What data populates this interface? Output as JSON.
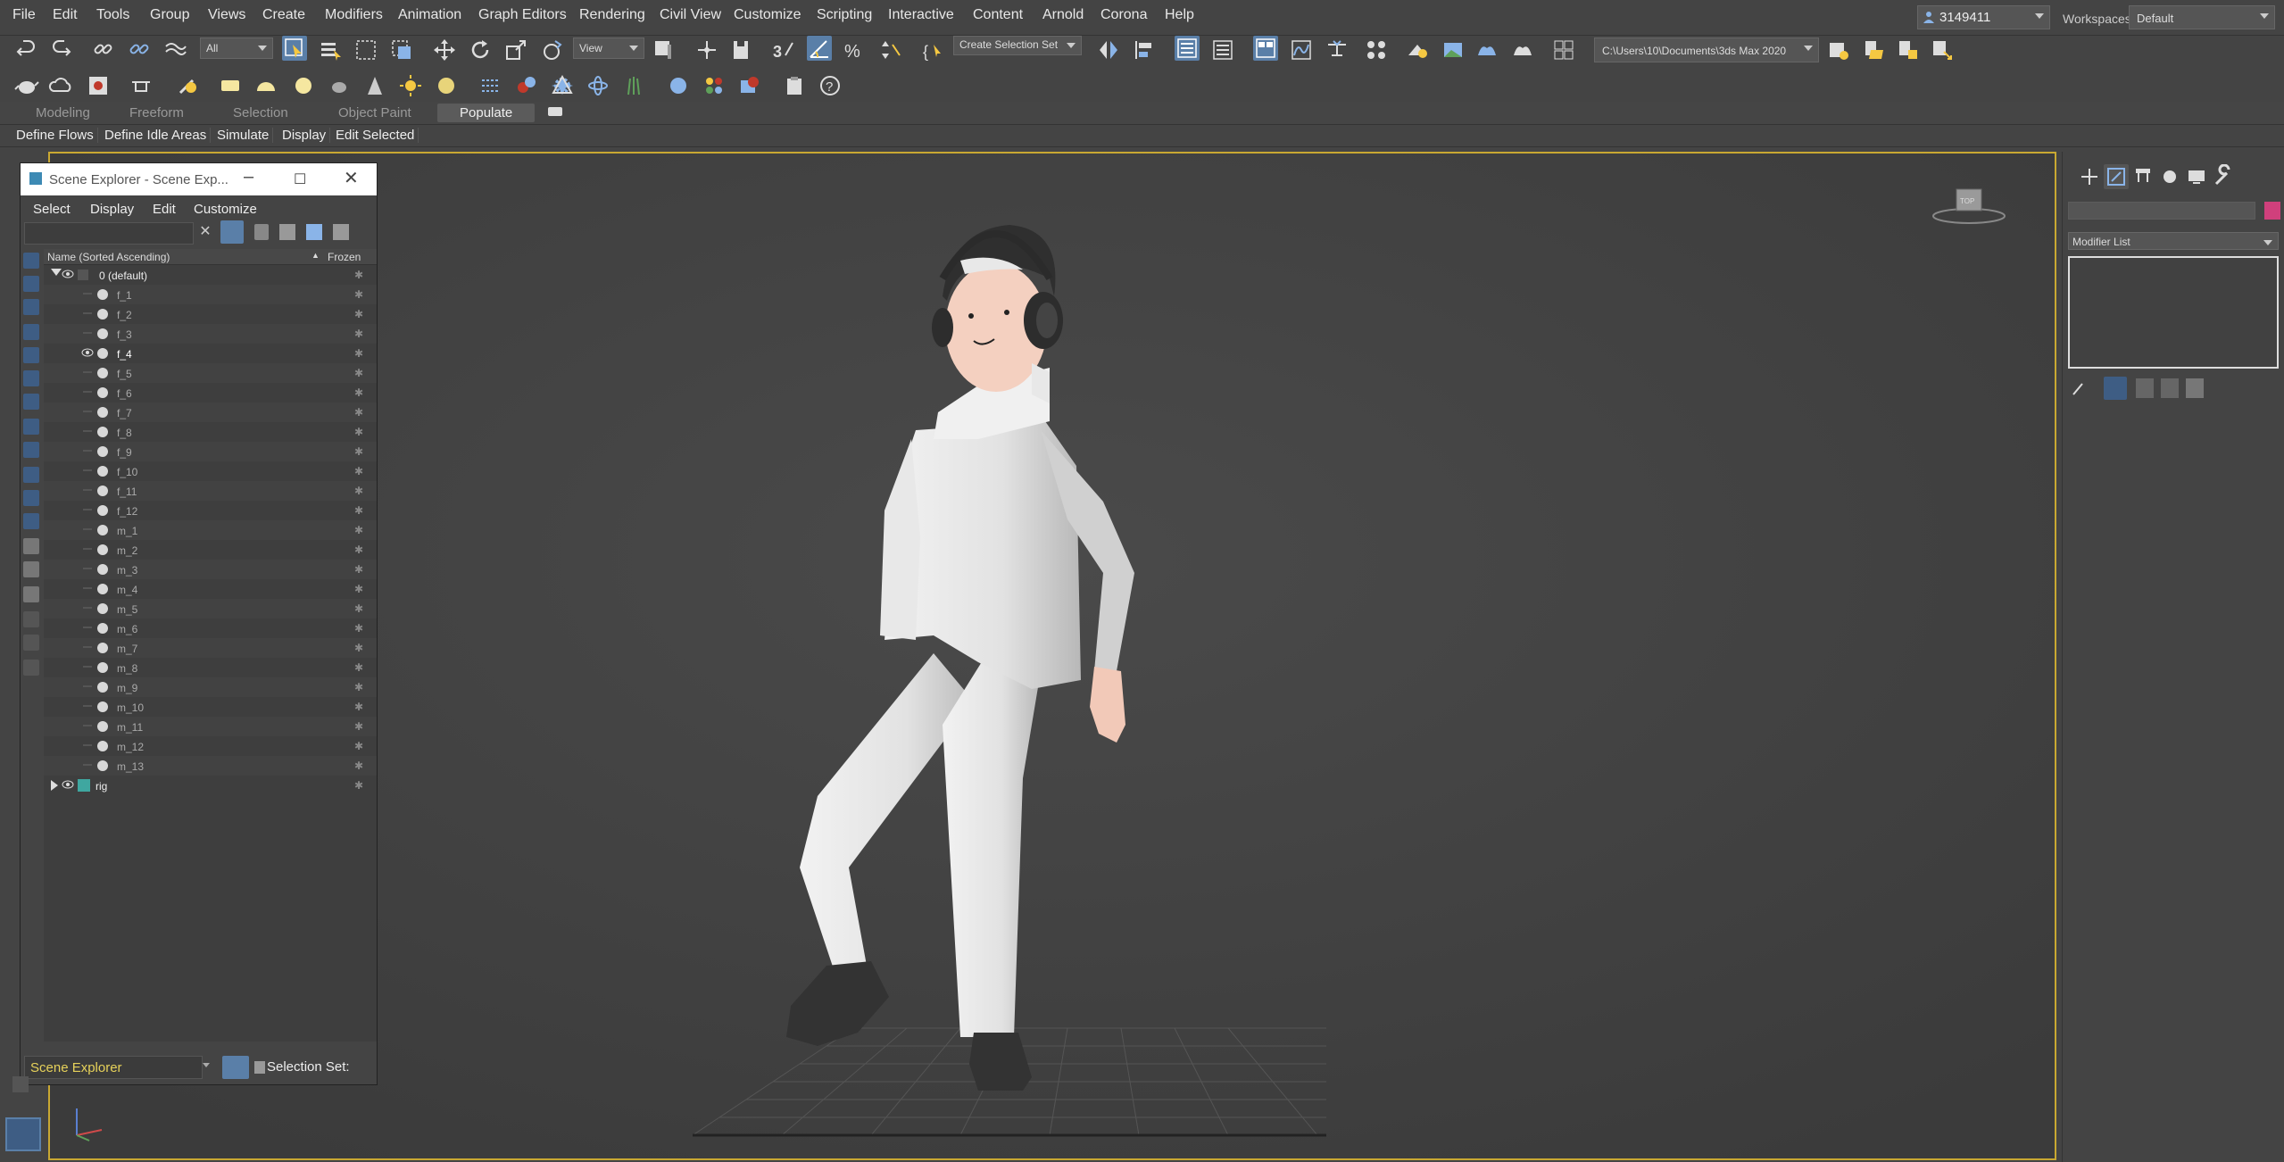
{
  "menu": [
    "File",
    "Edit",
    "Tools",
    "Group",
    "Views",
    "Create",
    "Modifiers",
    "Animation",
    "Graph Editors",
    "Rendering",
    "Civil View",
    "Customize",
    "Scripting",
    "Interactive",
    "Content",
    "Arnold",
    "Corona",
    "Help"
  ],
  "user": "3149411",
  "workspaces_label": "Workspaces:",
  "workspace": "Default",
  "toolbar": {
    "filter": "All",
    "refcoord": "View",
    "selection_set": "Create Selection Set",
    "project_path": "C:\\Users\\10\\Documents\\3ds Max 2020"
  },
  "ribbon_tabs": [
    "Modeling",
    "Freeform",
    "Selection",
    "Object Paint",
    "Populate"
  ],
  "ribbon_active": "Populate",
  "sub_ribbon": [
    "Define Flows",
    "Define Idle Areas",
    "Simulate",
    "Display",
    "Edit Selected"
  ],
  "scene_explorer": {
    "title": "Scene Explorer - Scene Exp...",
    "menu": [
      "Select",
      "Display",
      "Edit",
      "Customize"
    ],
    "col_name": "Name (Sorted Ascending)",
    "col_frozen": "Frozen",
    "layer_default": "0 (default)",
    "objects": [
      "f_1",
      "f_2",
      "f_3",
      "f_4",
      "f_5",
      "f_6",
      "f_7",
      "f_8",
      "f_9",
      "f_10",
      "f_11",
      "f_12",
      "m_1",
      "m_2",
      "m_3",
      "m_4",
      "m_5",
      "m_6",
      "m_7",
      "m_8",
      "m_9",
      "m_10",
      "m_11",
      "m_12",
      "m_13"
    ],
    "highlighted": "f_4",
    "layer_rig": "rig",
    "bottom_select": "Scene Explorer",
    "selection_set_label": "Selection Set:"
  },
  "command_panel": {
    "modifier_list": "Modifier List",
    "swatch_color": "#d0407c"
  },
  "viewcube_label": "TOP"
}
